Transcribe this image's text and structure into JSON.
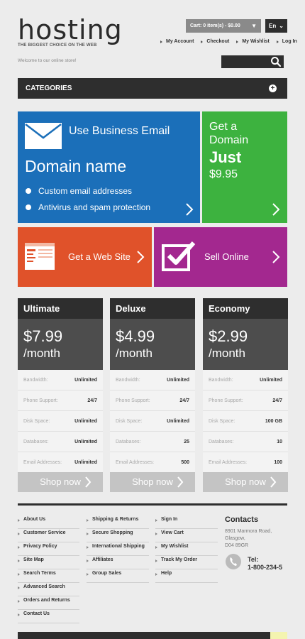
{
  "header": {
    "logo_title": "hosting",
    "logo_tagline": "THE BIGGEST CHOICE ON THE WEB",
    "cart_label": "Cart: 0 item(s) - $0.00",
    "language": "En",
    "top_links": [
      "My Account",
      "Checkout",
      "My Wishlist",
      "Log In"
    ],
    "welcome": "Welcome to our online store!",
    "search_placeholder": ""
  },
  "categories": {
    "label": "CATEGORIES"
  },
  "banners": {
    "email": {
      "title": "Use Business Email",
      "subtitle": "Domain name",
      "bullets": [
        "Custom email addresses",
        "Antivirus and spam protection"
      ],
      "color": "#1b6fb9"
    },
    "domain": {
      "line1": "Get a",
      "line2": "Domain",
      "just": "Just",
      "price": "$9.95",
      "color": "#3db23f"
    },
    "web": {
      "label": "Get a Web Site",
      "color": "#e0522a"
    },
    "sell": {
      "label": "Sell Online",
      "color": "#a3288f"
    }
  },
  "plans": [
    {
      "name": "Ultimate",
      "price": "$7.99",
      "period": "/month",
      "features": [
        {
          "k": "Bandwidth:",
          "v": "Unlimited"
        },
        {
          "k": "Phone Support:",
          "v": "24/7"
        },
        {
          "k": "Disk Space:",
          "v": "Unlimited"
        },
        {
          "k": "Databases:",
          "v": "Unlimited"
        },
        {
          "k": "Email Addresses:",
          "v": "Unlimited"
        }
      ],
      "button": "Shop now"
    },
    {
      "name": "Deluxe",
      "price": "$4.99",
      "period": "/month",
      "features": [
        {
          "k": "Bandwidth:",
          "v": "Unlimited"
        },
        {
          "k": "Phone Support:",
          "v": "24/7"
        },
        {
          "k": "Disk Space:",
          "v": "Unlimited"
        },
        {
          "k": "Databases:",
          "v": "25"
        },
        {
          "k": "Email Addresses:",
          "v": "500"
        }
      ],
      "button": "Shop now"
    },
    {
      "name": "Economy",
      "price": "$2.99",
      "period": "/month",
      "features": [
        {
          "k": "Bandwidth:",
          "v": "Unlimited"
        },
        {
          "k": "Phone Support:",
          "v": "24/7"
        },
        {
          "k": "Disk Space:",
          "v": "100 GB"
        },
        {
          "k": "Databases:",
          "v": "10"
        },
        {
          "k": "Email Addresses:",
          "v": "100"
        }
      ],
      "button": "Shop now"
    }
  ],
  "footer": {
    "col1": [
      "About Us",
      "Customer Service",
      "Privacy Policy",
      "Site Map",
      "Search Terms",
      "Advanced Search",
      "Orders and Returns",
      "Contact Us"
    ],
    "col2": [
      "Shipping & Returns",
      "Secure Shopping",
      "International Shipping",
      "Affiliates",
      "Group Sales"
    ],
    "col3": [
      "Sign In",
      "View Cart",
      "My Wishlist",
      "Track My Order",
      "Help"
    ],
    "contacts": {
      "title": "Contacts",
      "address": [
        "8901 Marmora Road,",
        "Glasgow,",
        "D04 89GR"
      ],
      "tel_label": "Tel:",
      "tel": "1-800-234-5"
    }
  }
}
